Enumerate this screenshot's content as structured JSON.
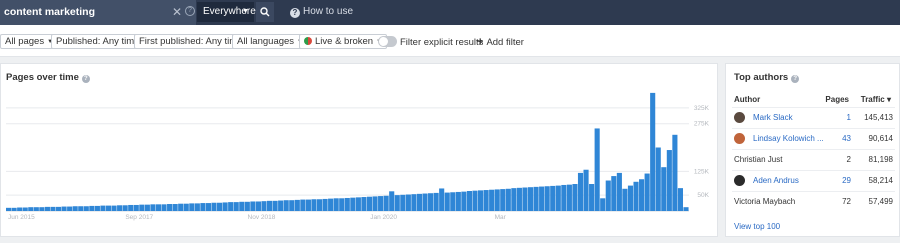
{
  "search": {
    "query": "content marketing",
    "scope": "Everywhere",
    "how_to_use": "How to use"
  },
  "filters": {
    "all_pages": "All pages",
    "published": "Published: Any time",
    "first_published": "First published: Any time",
    "all_languages": "All languages",
    "live_broken": "Live & broken",
    "filter_explicit": "Filter explicit results",
    "filter_explicit_on": false,
    "add_filter": "Add filter"
  },
  "chart": {
    "title": "Pages over time"
  },
  "chart_data": {
    "type": "bar",
    "title": "Pages over time",
    "color": "#2f86d6",
    "ylim": [
      0,
      400000
    ],
    "yticks": [
      "50K",
      "125K",
      "275K",
      "325K"
    ],
    "ytick_values": [
      50000,
      125000,
      275000,
      325000
    ],
    "xtick_labels": [
      "Jun 2015",
      "Sep 2017",
      "Nov 2018",
      "Jan 2020",
      "Mar"
    ],
    "xtick_indices": [
      0,
      24,
      46,
      68,
      89
    ],
    "values": [
      10000,
      10000,
      11000,
      11000,
      12000,
      12000,
      12000,
      13000,
      13000,
      13000,
      14000,
      14000,
      15000,
      15000,
      15000,
      16000,
      16000,
      17000,
      17000,
      17000,
      18000,
      18000,
      19000,
      19000,
      20000,
      20000,
      21000,
      21000,
      21000,
      22000,
      22000,
      23000,
      23000,
      24000,
      24000,
      25000,
      25000,
      26000,
      26000,
      27000,
      28000,
      28000,
      29000,
      29000,
      30000,
      30000,
      31000,
      32000,
      32000,
      33000,
      34000,
      34000,
      35000,
      36000,
      36000,
      37000,
      37000,
      38000,
      39000,
      40000,
      40000,
      41000,
      42000,
      43000,
      44000,
      45000,
      46000,
      47000,
      48000,
      62000,
      50000,
      51000,
      52000,
      53000,
      54000,
      55000,
      56000,
      57000,
      71000,
      58000,
      59000,
      60000,
      61000,
      63000,
      64000,
      65000,
      66000,
      67000,
      68000,
      69000,
      70000,
      72000,
      73000,
      74000,
      75000,
      76000,
      77000,
      78000,
      79000,
      80000,
      82000,
      83000,
      85000,
      120000,
      130000,
      85000,
      260000,
      40000,
      96000,
      110000,
      120000,
      70000,
      80000,
      92000,
      100000,
      118000,
      372000,
      200000,
      138000,
      192000,
      240000,
      72000,
      12000
    ],
    "xlabel": "",
    "ylabel": ""
  },
  "authors": {
    "title": "Top authors",
    "col_author": "Author",
    "col_pages": "Pages",
    "col_traffic": "Traffic ▾",
    "rows": [
      {
        "name": "Mark Slack",
        "pages": "1",
        "traffic": "145,413",
        "linked": true,
        "avatar_color": "#5a4a3f"
      },
      {
        "name": "Lindsay Kolowich ...",
        "pages": "43",
        "traffic": "90,614",
        "linked": true,
        "avatar_color": "#c0643a"
      },
      {
        "name": "Christian Just",
        "pages": "2",
        "traffic": "81,198",
        "linked": false,
        "avatar_color": ""
      },
      {
        "name": "Aden Andrus",
        "pages": "29",
        "traffic": "58,214",
        "linked": true,
        "avatar_color": "#2b2b2b"
      },
      {
        "name": "Victoria Maybach",
        "pages": "72",
        "traffic": "57,499",
        "linked": false,
        "avatar_color": ""
      }
    ],
    "view_top": "View top 100"
  }
}
